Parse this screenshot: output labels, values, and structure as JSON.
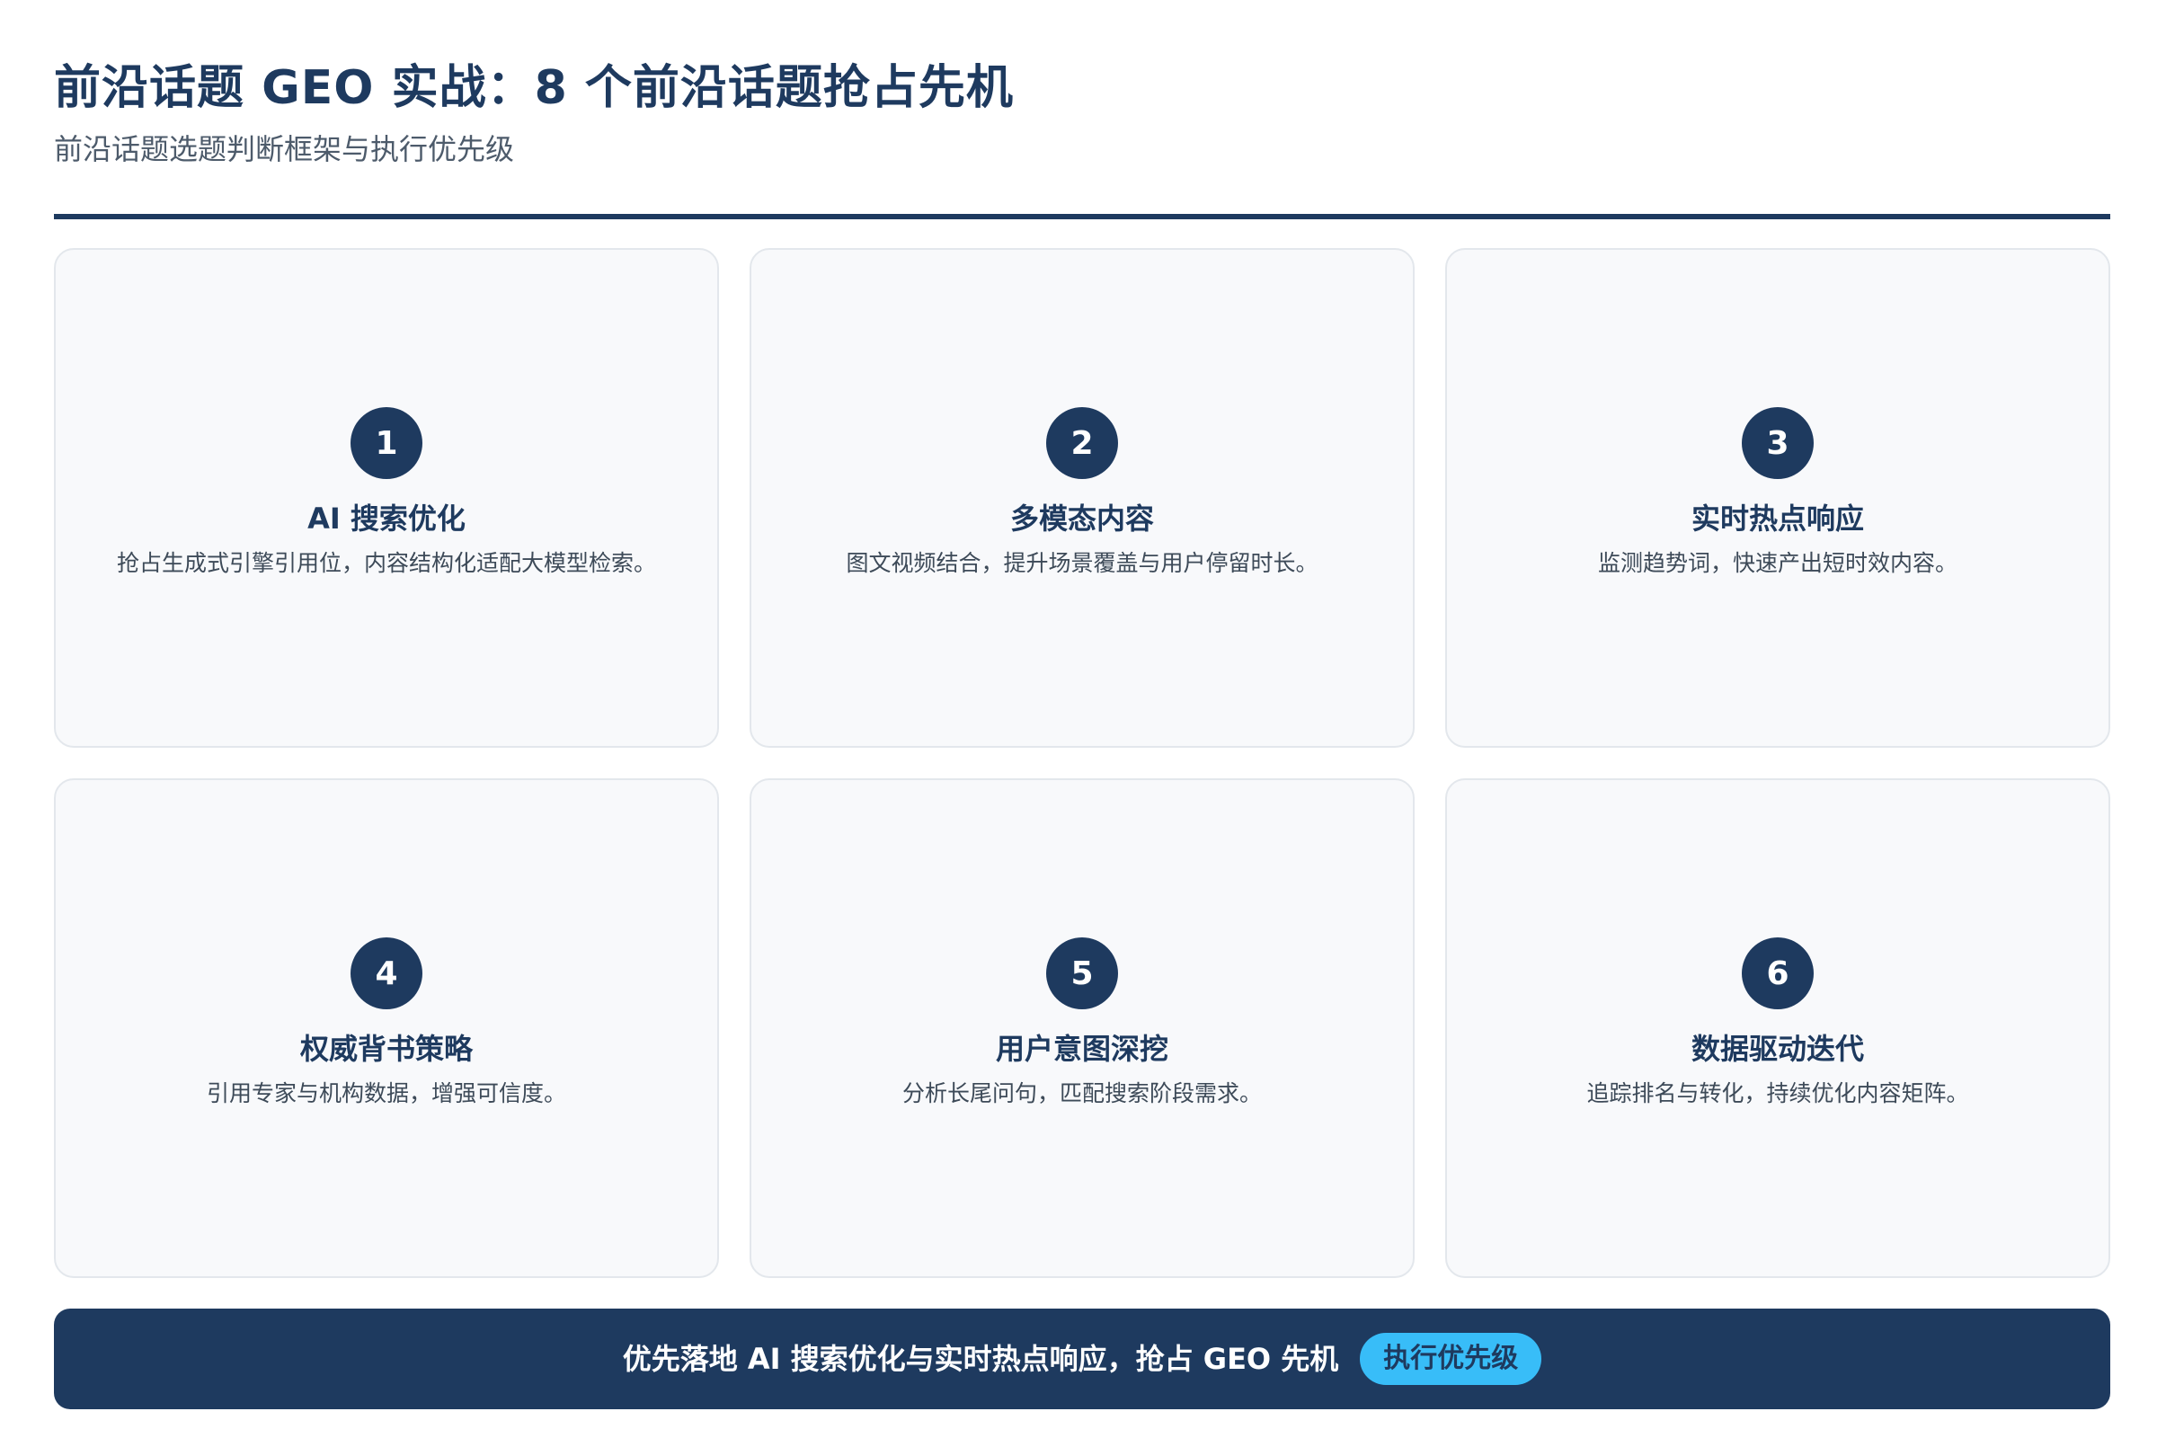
{
  "header": {
    "title": "前沿话题 GEO 实战：8 个前沿话题抢占先机",
    "subtitle": "前沿话题选题判断框架与执行优先级"
  },
  "colors": {
    "primary": "#1e3a5f",
    "accent": "#38bdf8",
    "card_bg": "#f8f9fb",
    "card_border": "#e3e7ec"
  },
  "cards": [
    {
      "number": "1",
      "title": "AI 搜索优化",
      "description": "抢占生成式引擎引用位，内容结构化适配大模型检索。"
    },
    {
      "number": "2",
      "title": "多模态内容",
      "description": "图文视频结合，提升场景覆盖与用户停留时长。"
    },
    {
      "number": "3",
      "title": "实时热点响应",
      "description": "监测趋势词，快速产出短时效内容。"
    },
    {
      "number": "4",
      "title": "权威背书策略",
      "description": "引用专家与机构数据，增强可信度。"
    },
    {
      "number": "5",
      "title": "用户意图深挖",
      "description": "分析长尾问句，匹配搜索阶段需求。"
    },
    {
      "number": "6",
      "title": "数据驱动迭代",
      "description": "追踪排名与转化，持续优化内容矩阵。"
    }
  ],
  "banner": {
    "text": "优先落地 AI 搜索优化与实时热点响应，抢占 GEO 先机",
    "pill": "执行优先级"
  }
}
